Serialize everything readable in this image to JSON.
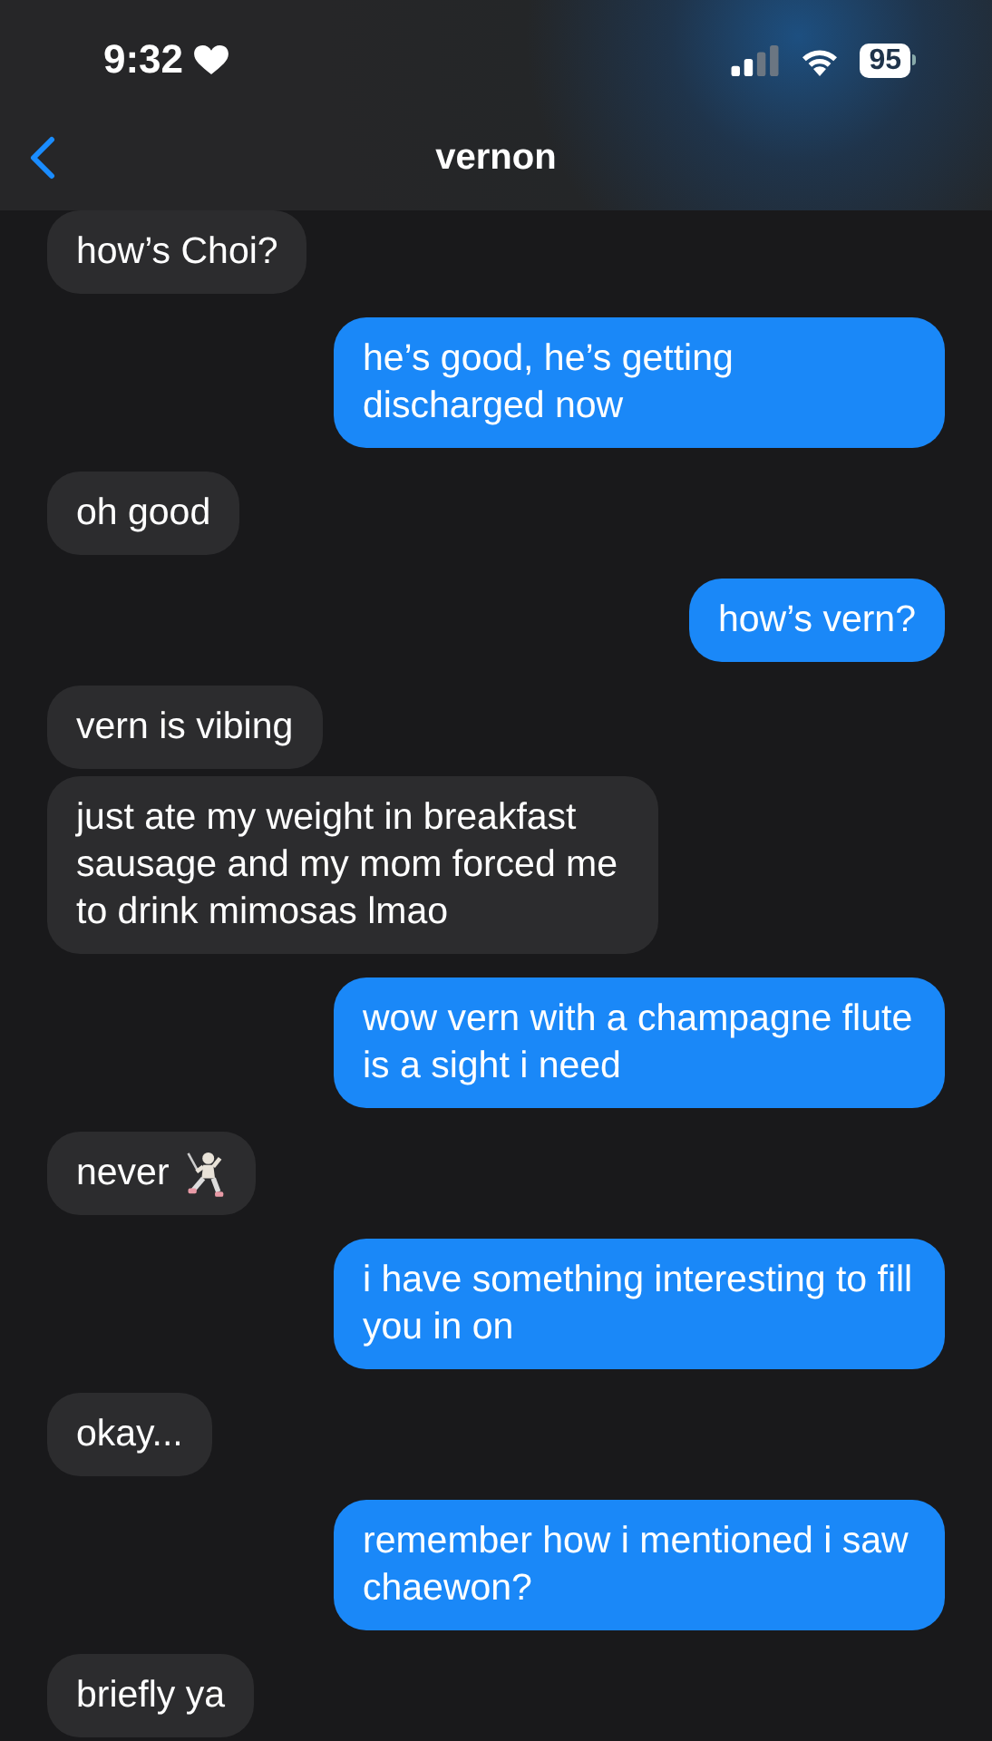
{
  "status_bar": {
    "time": "9:32",
    "battery": "95"
  },
  "header": {
    "title": "vernon"
  },
  "messages": [
    {
      "outgoing": false,
      "kind": "text",
      "text": "how’s Choi?"
    },
    {
      "outgoing": true,
      "kind": "text",
      "text": "he’s good, he’s getting discharged now"
    },
    {
      "outgoing": false,
      "kind": "text",
      "text": "oh good"
    },
    {
      "outgoing": true,
      "kind": "text",
      "text": "how’s vern?"
    },
    {
      "outgoing": false,
      "kind": "text",
      "text": "vern is vibing"
    },
    {
      "outgoing": false,
      "kind": "text",
      "text": "just ate my weight in breakfast sausage and my mom forced me to drink mimosas lmao"
    },
    {
      "outgoing": true,
      "kind": "text",
      "text": "wow vern with a champagne flute is a sight i need"
    },
    {
      "outgoing": false,
      "kind": "text_icon",
      "text": "never"
    },
    {
      "outgoing": true,
      "kind": "text",
      "text": "i have something interesting to fill you in on"
    },
    {
      "outgoing": false,
      "kind": "text",
      "text": "okay..."
    },
    {
      "outgoing": true,
      "kind": "text",
      "text": "remember how i mentioned i saw chaewon?"
    },
    {
      "outgoing": false,
      "kind": "text",
      "text": "briefly ya"
    }
  ]
}
